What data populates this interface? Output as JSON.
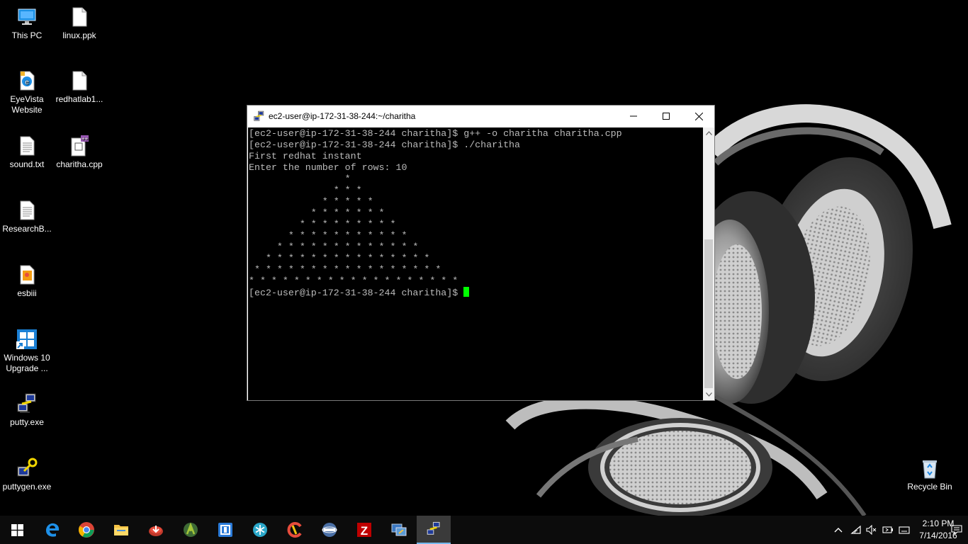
{
  "desktop": {
    "icons": [
      {
        "label": "This PC",
        "icon": "this-pc-icon"
      },
      {
        "label": "linux.ppk",
        "icon": "file-icon"
      },
      {
        "label": "EyeVista Website",
        "icon": "web-shortcut-icon"
      },
      {
        "label": "redhatlab1...",
        "icon": "file-icon"
      },
      {
        "label": "sound.txt",
        "icon": "text-file-icon"
      },
      {
        "label": "charitha.cpp",
        "icon": "cpp-file-icon"
      },
      {
        "label": "ResearchB...",
        "icon": "text-file-icon"
      },
      {
        "label": "esbiii",
        "icon": "image-file-icon"
      },
      {
        "label": "Windows 10 Upgrade ...",
        "icon": "windows-upgrade-icon"
      },
      {
        "label": "putty.exe",
        "icon": "putty-icon"
      },
      {
        "label": "puttygen.exe",
        "icon": "puttygen-icon"
      },
      {
        "label": "Recycle Bin",
        "icon": "recycle-bin-icon"
      }
    ]
  },
  "window": {
    "title": "ec2-user@ip-172-31-38-244:~/charitha",
    "terminal_lines": [
      "[ec2-user@ip-172-31-38-244 charitha]$ g++ -o charitha charitha.cpp",
      "[ec2-user@ip-172-31-38-244 charitha]$ ./charitha",
      "First redhat instant",
      "Enter the number of rows: 10",
      "                 *",
      "               * * *",
      "             * * * * *",
      "           * * * * * * *",
      "         * * * * * * * * *",
      "       * * * * * * * * * * *",
      "     * * * * * * * * * * * * *",
      "   * * * * * * * * * * * * * * *",
      " * * * * * * * * * * * * * * * * *",
      "* * * * * * * * * * * * * * * * * * *"
    ],
    "prompt": "[ec2-user@ip-172-31-38-244 charitha]$ ",
    "cursor_color": "#00ff00"
  },
  "taskbar": {
    "apps": [
      "edge-icon",
      "chrome-icon",
      "file-explorer-icon",
      "download-app-icon",
      "android-studio-icon",
      "app-box-icon",
      "snowflake-app-icon",
      "ccleaner-icon",
      "network-app-icon",
      "filezilla-icon",
      "remote-desktop-icon",
      "putty-icon"
    ],
    "active_app": "putty-icon",
    "clock": {
      "time": "2:10 PM",
      "date": "7/14/2016"
    }
  },
  "colors": {
    "taskbar": "#0c0c0c",
    "accent": "#76b9ed",
    "terminal_bg": "#000000",
    "terminal_fg": "#bbbbbb"
  }
}
